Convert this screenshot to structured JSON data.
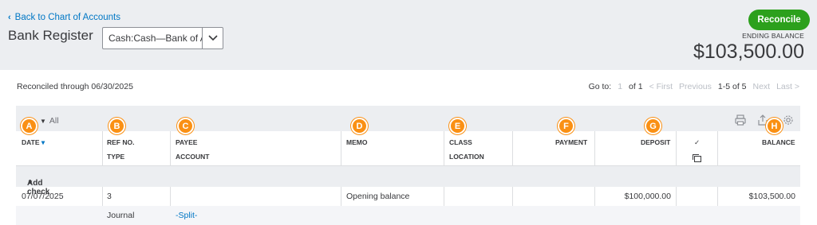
{
  "header": {
    "back_link": "Back to Chart of Accounts",
    "title": "Bank Register",
    "account_value": "Cash:Cash—Bank of Am",
    "reconcile_label": "Reconcile",
    "ending_balance_label": "ENDING BALANCE",
    "ending_balance_value": "$103,500.00"
  },
  "status": {
    "reconciled_through": "Reconciled through 06/30/2025"
  },
  "pager": {
    "goto_label": "Go to:",
    "page_current": "1",
    "page_total": "of 1",
    "first": "< First",
    "previous": "Previous",
    "range": "1-5 of 5",
    "next": "Next",
    "last": "Last >"
  },
  "toolbar": {
    "filter_label": "All"
  },
  "columns": {
    "date": "DATE",
    "ref_no": "REF NO.",
    "type": "TYPE",
    "payee": "PAYEE",
    "account": "ACCOUNT",
    "memo": "MEMO",
    "class": "CLASS",
    "location": "LOCATION",
    "payment": "PAYMENT",
    "deposit": "DEPOSIT",
    "check_mark": "✓",
    "balance": "BALANCE"
  },
  "add_check": "Add check",
  "rows": [
    {
      "date": "07/07/2025",
      "ref_no": "3",
      "type": "Journal",
      "payee": "",
      "account": "-Split-",
      "memo": "Opening balance",
      "deposit": "$100,000.00",
      "balance": "$103,500.00"
    }
  ],
  "badges": [
    "A",
    "B",
    "C",
    "D",
    "E",
    "F",
    "G",
    "H"
  ],
  "colors": {
    "accent": "#2ca01c",
    "link": "#0077c5",
    "badge": "#fa9014"
  }
}
